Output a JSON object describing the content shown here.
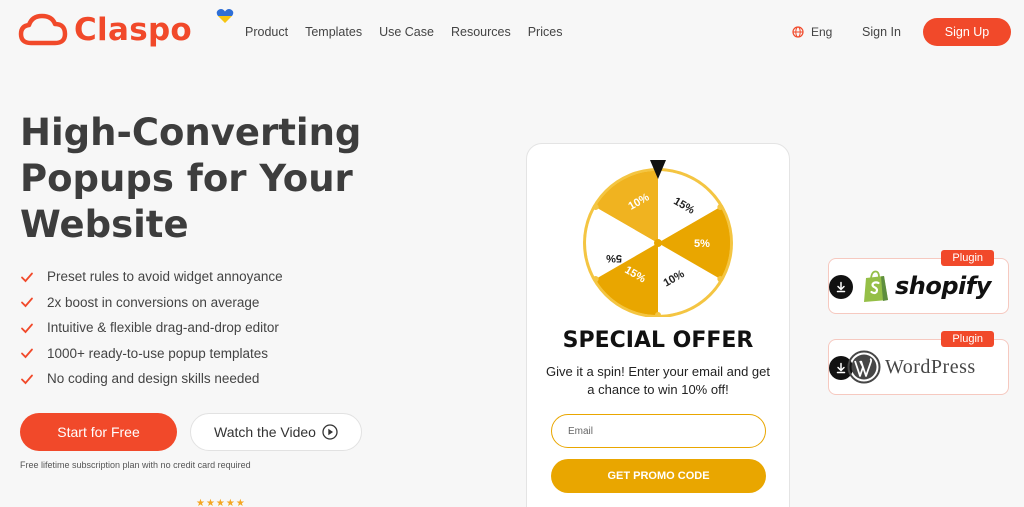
{
  "header": {
    "brand": "Claspo",
    "nav": [
      "Product",
      "Templates",
      "Use Case",
      "Resources",
      "Prices"
    ],
    "language": "Eng",
    "sign_in": "Sign In",
    "sign_up": "Sign Up"
  },
  "hero": {
    "title": "High-Converting Popups for Your Website",
    "features": [
      "Preset rules to avoid widget annoyance",
      "2x boost in conversions on average",
      "Intuitive & flexible drag-and-drop editor",
      "1000+ ready-to-use popup templates",
      "No coding and design skills needed"
    ],
    "start_button": "Start for Free",
    "video_button": "Watch the Video",
    "fine_print": "Free lifetime subscription plan with no credit card required",
    "stars": "★★★★★"
  },
  "popup": {
    "wheel_segments": [
      "15%",
      "5%",
      "10%",
      "15%",
      "5%",
      "10%"
    ],
    "title": "SPECIAL OFFER",
    "text": "Give it a spin! Enter your email and get a chance to win 10% off!",
    "email_placeholder": "Email",
    "promo_button": "GET PROMO CODE"
  },
  "plugins": [
    {
      "badge": "Plugin",
      "name": "shopify"
    },
    {
      "badge": "Plugin",
      "name": "WordPress"
    }
  ],
  "colors": {
    "brand": "#f1492a",
    "wheel_gold": "#e9a600",
    "text_dark": "#3d3d3d"
  },
  "icons": [
    "cloud-logo-icon",
    "heart-icon",
    "globe-icon",
    "check-icon",
    "play-icon",
    "download-icon",
    "shopify-bag-icon",
    "wordpress-icon",
    "wheel-pointer-icon"
  ]
}
